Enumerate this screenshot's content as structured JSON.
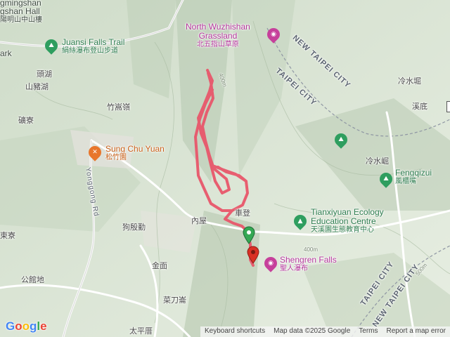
{
  "labels": {
    "yangmingshan_partial": "gmingshan",
    "hall_partial": "gshan Hall",
    "hall_zh_partial": "陽明山中山樓",
    "park_partial": "ark",
    "toumao": "頭湖",
    "shanzhuhu": "山豬湖",
    "zhuzihu": "竹嵩嶺",
    "kuangliao": "礦寮",
    "dongli": "東寮",
    "gonguandi": "公館地",
    "gouyinkeng": "狗殷勤",
    "neiwu": "內屋",
    "jinmian": "金面",
    "caidaolun": "菜刀崙",
    "taipingjia": "太平厝",
    "chedeng": "車登",
    "lengshuikeng": "冷水堀",
    "xidi": "溪底",
    "lengshuiku2": "冷水崛",
    "elev_400": "400m",
    "elev_500": "500m",
    "elev_300": "300m"
  },
  "pois": {
    "juansi": {
      "en": "Juansi Falls Trail",
      "zh": "絹絲瀑布登山步道",
      "icon": "hiking-icon"
    },
    "wuzhishan": {
      "en": "North Wuzhishan",
      "en2": "Grassland",
      "zh": "北五指山草原",
      "icon": "camera-icon"
    },
    "sungchu": {
      "en": "Sung Chu Yuan",
      "zh": "松竹園",
      "icon": "restaurant-icon"
    },
    "tianxiyuan": {
      "en": "Tianxiyuan Ecology",
      "en2": "Education Centre",
      "zh": "天溪園生態教育中心",
      "icon": "tree-icon"
    },
    "shengren": {
      "en": "Shengren Falls",
      "zh": "聖人瀑布",
      "icon": "camera-icon"
    },
    "fengqizui": {
      "en": "Fengqizui",
      "zh": "風櫃嘴",
      "icon": "hiking-icon"
    }
  },
  "roads": {
    "ntc_top": "NEW TAIPEI CITY",
    "tc_top": "TAIPEI CITY",
    "yongong": "Yonggong Rd",
    "tc_bottom": "TAIPEI CITY",
    "ntc_bottom": "NEW TAIPEI CITY"
  },
  "colors": {
    "track": "#e8566a",
    "start_marker": "#34a853",
    "end_marker": "#d93025"
  },
  "attribution": {
    "logo": "Google",
    "shortcuts": "Keyboard shortcuts",
    "mapdata": "Map data ©2025 Google",
    "terms": "Terms",
    "report": "Report a map error"
  }
}
